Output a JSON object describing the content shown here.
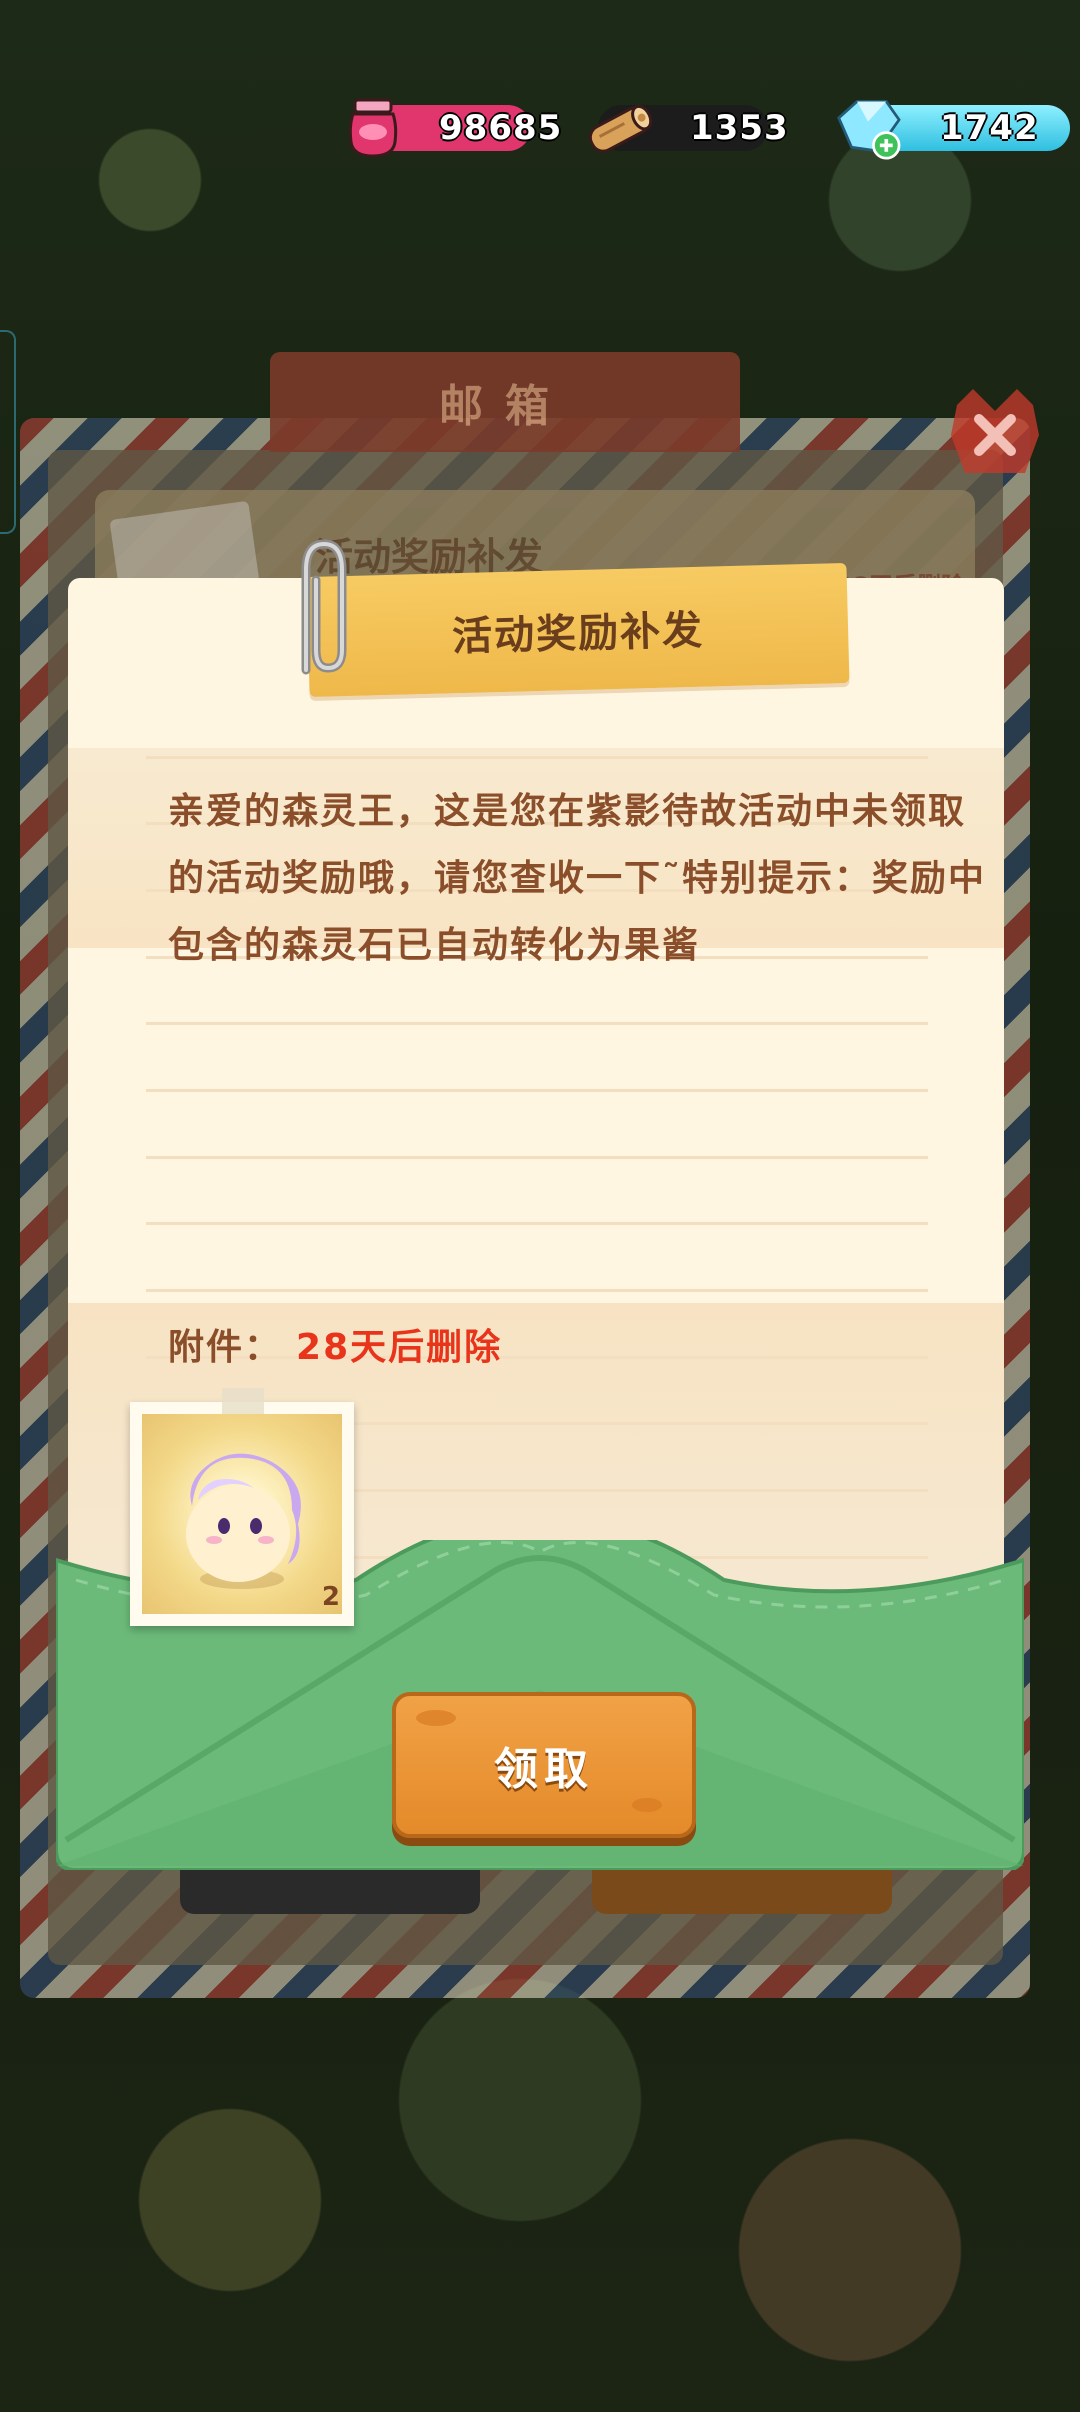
{
  "resources": {
    "jam": {
      "value": "98685",
      "icon": "jam-jar-icon"
    },
    "wood": {
      "value": "1353",
      "icon": "wood-log-icon"
    },
    "gem": {
      "value": "1742",
      "icon": "gem-add-icon"
    }
  },
  "mailbox": {
    "title": "邮箱",
    "behind_row_title": "活动奖励补发",
    "behind_row_expiry": "28天后删除"
  },
  "letter": {
    "title": "活动奖励补发",
    "body": "亲爱的森灵王，这是您在紫影待故活动中未领取的活动奖励哦，请您查收一下˜特别提示：奖励中包含的森灵石已自动转化为果酱",
    "attachment_label": "附件：",
    "attachment_expiry": "28天后删除",
    "attachment_item": {
      "count": "2",
      "icon": "purple-hair-spirit-icon"
    }
  },
  "claim_button": {
    "label": "领取"
  },
  "colors": {
    "jam_pill": "#e0356d",
    "gem_pill": "#2fbfe0",
    "title_tape": "#f7cb62",
    "body_text": "#8a4e2a",
    "expiry_text": "#e8341a",
    "envelope_green": "#6cba7a",
    "claim_button": "#e48a2a"
  }
}
